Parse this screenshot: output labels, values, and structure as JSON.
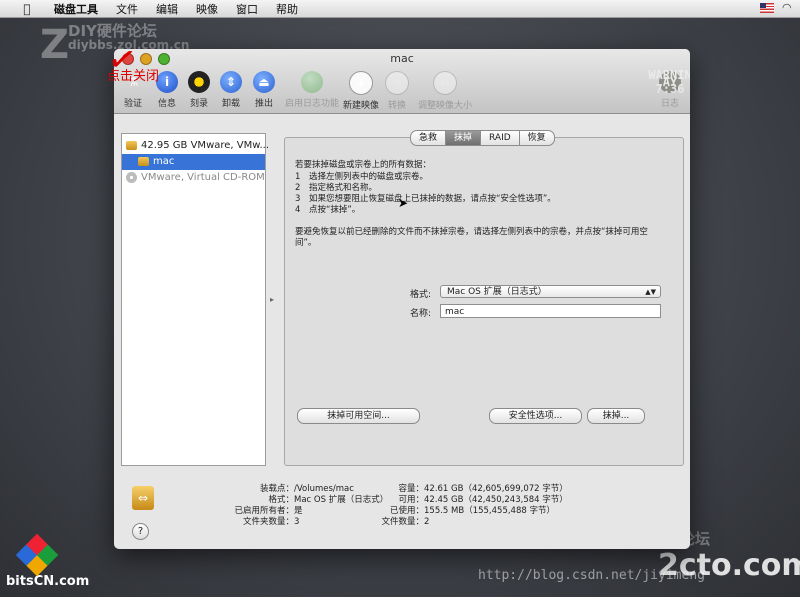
{
  "menubar": {
    "apple_icon": "apple-logo-icon",
    "app_name": "磁盘工具",
    "items": [
      "文件",
      "编辑",
      "映像",
      "窗口",
      "帮助"
    ]
  },
  "watermarks": {
    "top_brand": "DIY硬件论坛",
    "top_url": "diybbs.zol.com.cn",
    "bottom_brand": "论坛",
    "bottom_url": "http://blog.csdn.net/jiyimeng",
    "logo_text": "bitsCN.com",
    "logo2_text": "2cto.com"
  },
  "annotation": {
    "label": "点击关闭"
  },
  "window": {
    "title": "mac",
    "toolbar": [
      {
        "label": "验证",
        "icon": "microscope-icon",
        "enabled": true
      },
      {
        "label": "信息",
        "icon": "info-icon",
        "enabled": true
      },
      {
        "label": "刻录",
        "icon": "burn-icon",
        "enabled": true
      },
      {
        "label": "卸载",
        "icon": "unmount-icon",
        "enabled": true
      },
      {
        "label": "推出",
        "icon": "eject-icon",
        "enabled": true
      },
      {
        "label": "启用日志功能",
        "icon": "journal-icon",
        "enabled": false
      },
      {
        "label": "新建映像",
        "icon": "new-image-icon",
        "enabled": true
      },
      {
        "label": "转换",
        "icon": "convert-icon",
        "enabled": false
      },
      {
        "label": "调整映像大小",
        "icon": "resize-image-icon",
        "enabled": false
      },
      {
        "label": "日志",
        "icon": "log-icon",
        "enabled": false
      }
    ],
    "log_icon_text": "WARNIN\nAY 7:36",
    "sidebar": [
      {
        "label": "42.95 GB VMware, VMw...",
        "type": "disk",
        "selected": false
      },
      {
        "label": "mac",
        "type": "volume",
        "selected": true
      },
      {
        "label": "VMware, Virtual CD-ROM",
        "type": "cdrom",
        "selected": false
      }
    ],
    "tabs": [
      {
        "label": "急救",
        "active": false
      },
      {
        "label": "抹掉",
        "active": true
      },
      {
        "label": "RAID",
        "active": false
      },
      {
        "label": "恢复",
        "active": false
      }
    ],
    "erase": {
      "intro": "若要抹掉磁盘或宗卷上的所有数据：",
      "steps": [
        {
          "num": "1",
          "text": "选择左侧列表中的磁盘或宗卷。"
        },
        {
          "num": "2",
          "text": "指定格式和名称。"
        },
        {
          "num": "3",
          "text": "如果您想要阻止恢复磁盘上已抹掉的数据，请点按“安全性选项”。"
        },
        {
          "num": "4",
          "text": "点按“抹掉”。"
        }
      ],
      "free_space_note_line1": "要避免恢复以前已经删除的文件而不抹掉宗卷，请选择左侧列表中的宗卷，并点按“抹掉可用空",
      "free_space_note_line2": "间”。",
      "format_label": "格式:",
      "format_value": "Mac OS 扩展（日志式）",
      "name_label": "名称:",
      "name_value": "mac",
      "erase_free_space_button": "抹掉可用空间...",
      "security_options_button": "安全性选项...",
      "erase_button": "抹掉..."
    },
    "info": {
      "left": [
        {
          "key": "装载点：",
          "value": "/Volumes/mac"
        },
        {
          "key": "格式：",
          "value": "Mac OS 扩展（日志式）"
        },
        {
          "key": "已启用所有者：",
          "value": "是"
        },
        {
          "key": "文件夹数量：",
          "value": "3"
        }
      ],
      "right": [
        {
          "key": "容量：",
          "value": "42.61 GB（42,605,699,072 字节）"
        },
        {
          "key": "可用：",
          "value": "42.45 GB（42,450,243,584 字节）"
        },
        {
          "key": "已使用：",
          "value": "155.5 MB（155,455,488 字节）"
        },
        {
          "key": "文件数量：",
          "value": "2"
        }
      ],
      "help": "?"
    }
  }
}
